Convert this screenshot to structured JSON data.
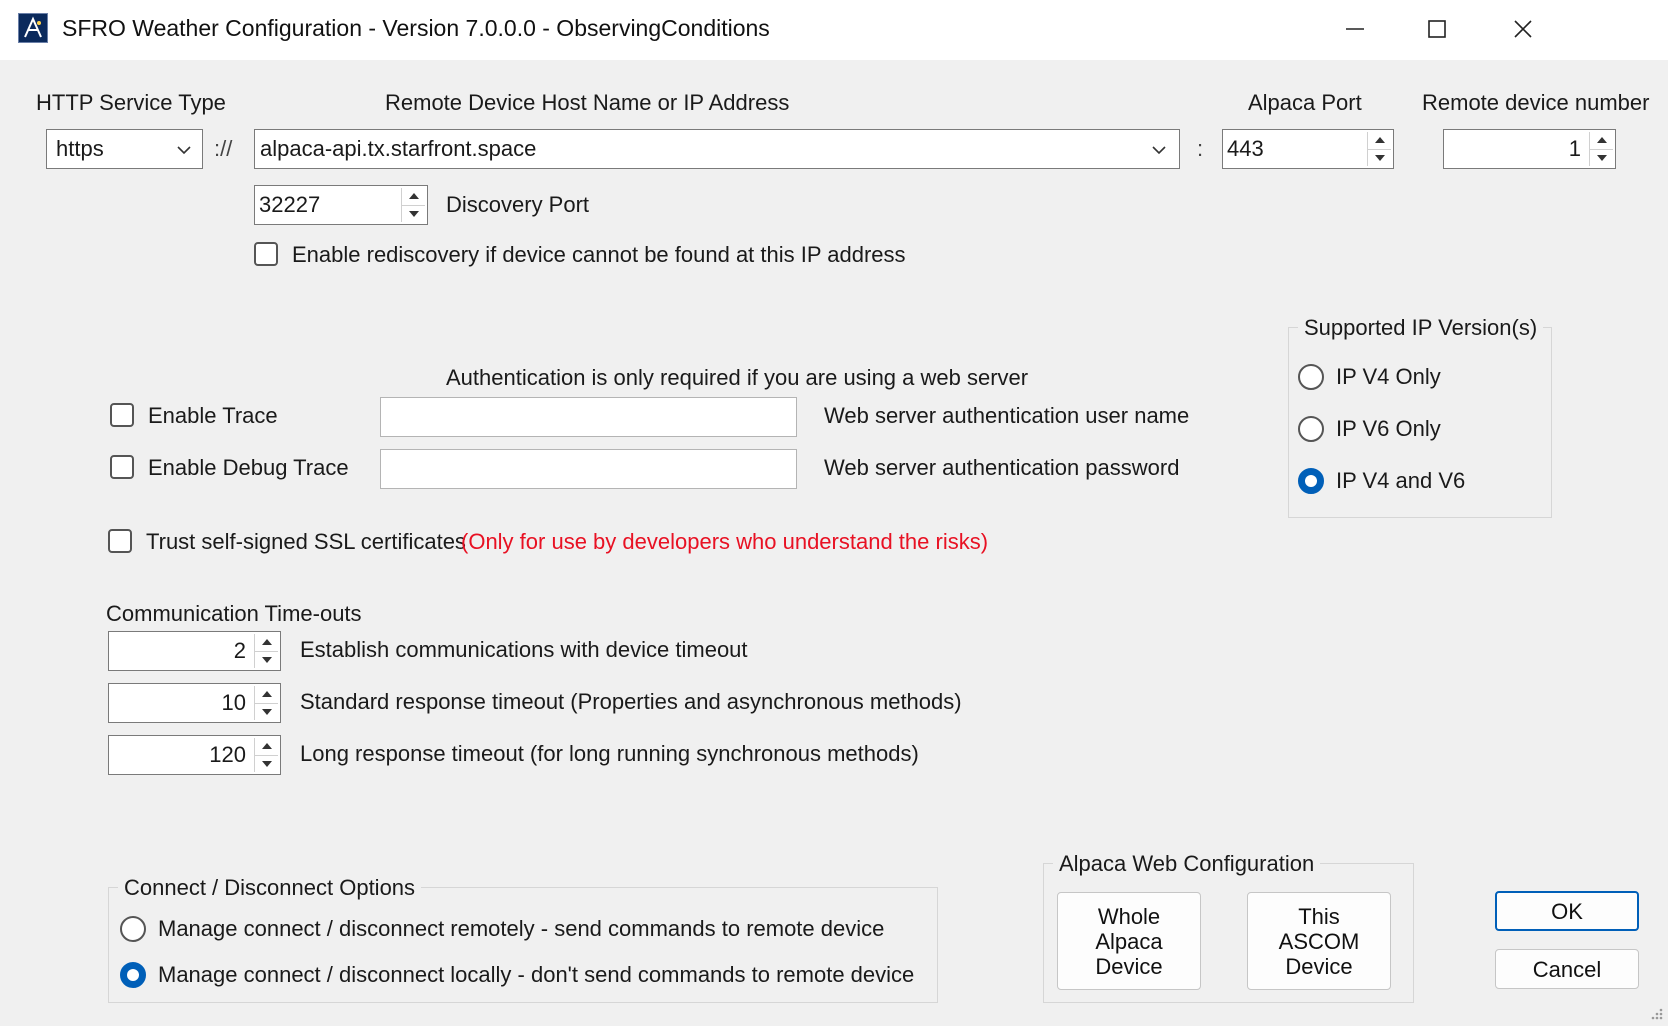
{
  "window": {
    "title": "SFRO Weather Configuration - Version 7.0.0.0 - ObservingConditions",
    "icons": {
      "app": "ascom-app-icon",
      "minimize": "minimize-icon",
      "maximize": "maximize-icon",
      "close": "close-icon"
    }
  },
  "connection": {
    "service_type_label": "HTTP Service Type",
    "service_type_value": "https",
    "separator": "://",
    "host_label": "Remote Device Host Name or IP Address",
    "host_value": "alpaca-api.tx.starfront.space",
    "port_separator": ":",
    "port_label": "Alpaca Port",
    "port_value": "443",
    "device_number_label": "Remote device number",
    "device_number_value": "1",
    "discovery_port_value": "32227",
    "discovery_port_label": "Discovery Port",
    "rediscovery_label": "Enable rediscovery if device cannot be found at this IP address",
    "rediscovery_checked": false
  },
  "ip_version": {
    "title": "Supported IP Version(s)",
    "options": [
      "IP V4 Only",
      "IP V6 Only",
      "IP V4 and V6"
    ],
    "selected": "IP V4 and V6"
  },
  "auth": {
    "note": "Authentication is only required if you are using a web server",
    "user_label": "Web server authentication user name",
    "user_value": "",
    "password_label": "Web server authentication password",
    "password_value": ""
  },
  "trace": {
    "enable_trace_label": "Enable Trace",
    "enable_trace_checked": false,
    "enable_debug_trace_label": "Enable Debug Trace",
    "enable_debug_trace_checked": false
  },
  "ssl": {
    "label": "Trust self-signed SSL certificates",
    "warning": "(Only for use by developers who understand the risks)",
    "checked": false,
    "warning_color": "#e81123"
  },
  "timeouts": {
    "title": "Communication Time-outs",
    "establish_value": "2",
    "establish_label": "Establish communications with device timeout",
    "standard_value": "10",
    "standard_label": "Standard response timeout (Properties and asynchronous methods)",
    "long_value": "120",
    "long_label": "Long response timeout (for long running synchronous methods)"
  },
  "connect_options": {
    "title": "Connect / Disconnect Options",
    "remote_label": "Manage connect / disconnect remotely - send commands to remote device",
    "local_label": "Manage connect / disconnect locally - don't send commands to remote device",
    "selected": "local"
  },
  "web_config": {
    "title": "Alpaca Web Configuration",
    "whole_device_label": "Whole\nAlpaca\nDevice",
    "this_device_label": "This\nASCOM\nDevice"
  },
  "buttons": {
    "ok": "OK",
    "cancel": "Cancel"
  },
  "colors": {
    "accent": "#005fb8",
    "background": "#f0f0f0",
    "titlebar": "#ffffff"
  }
}
